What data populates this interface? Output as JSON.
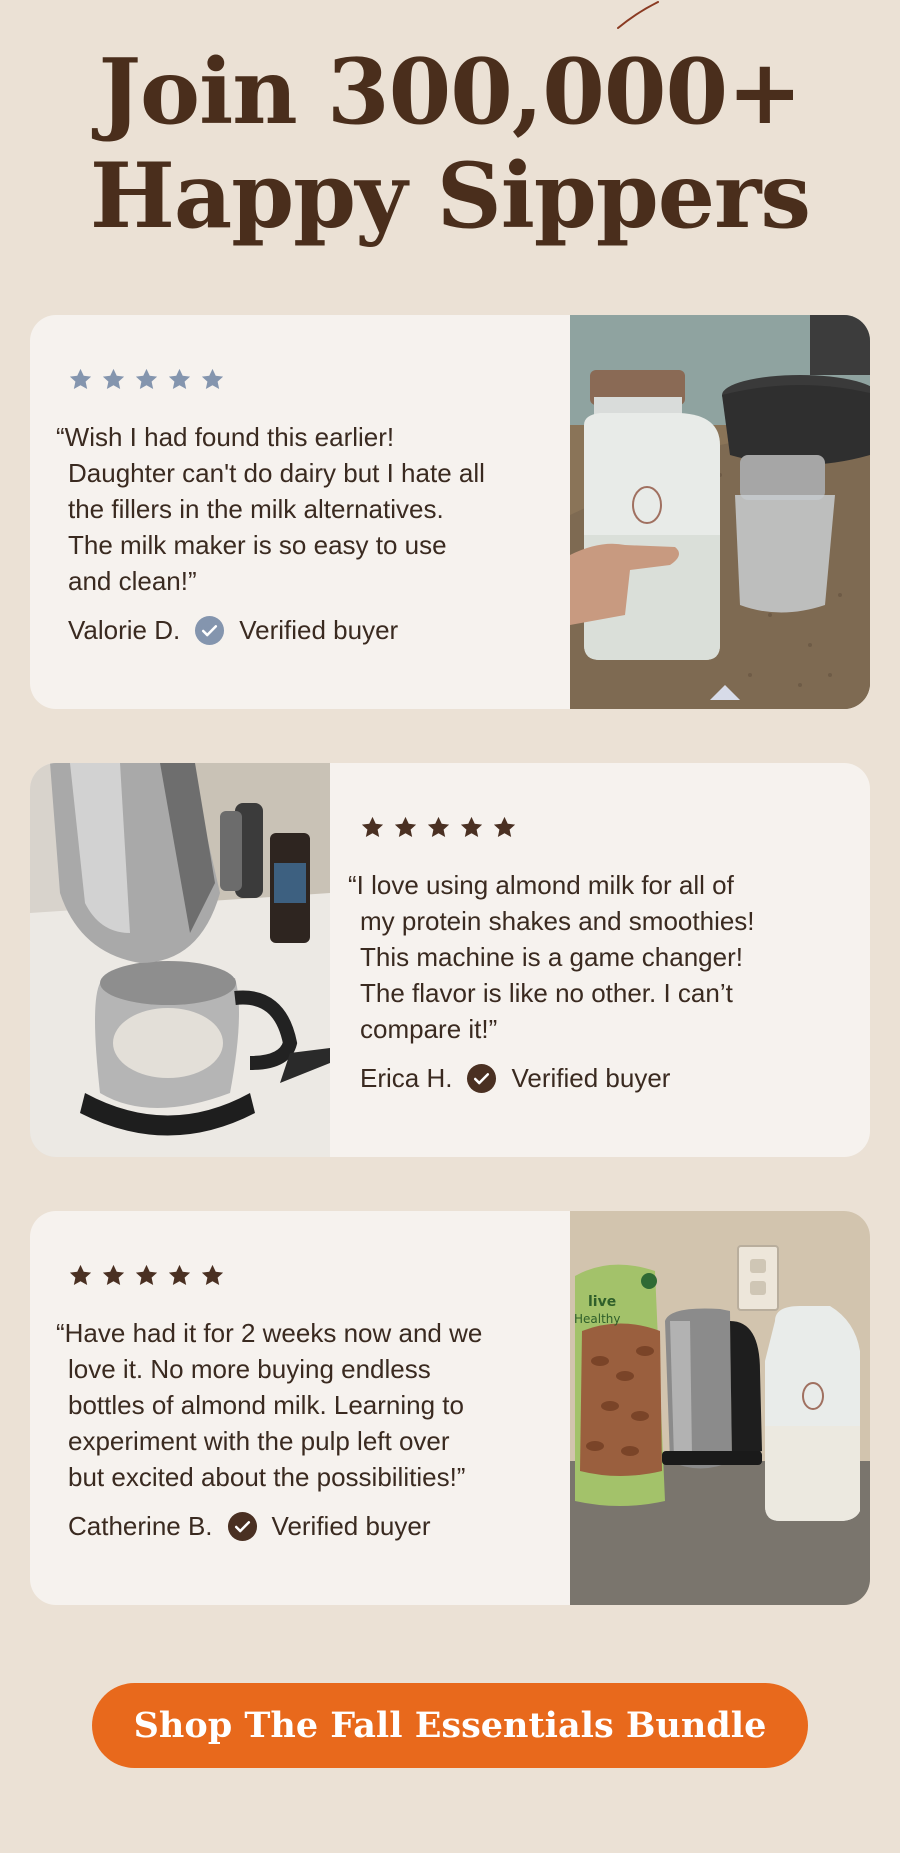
{
  "headline": {
    "line1": "Join 300,000+",
    "line2": "Happy Sippers"
  },
  "reviews": [
    {
      "rating": 5,
      "star_color": "#8495ae",
      "quote": "“Wish I had found this earlier!\nDaughter can't do dairy but I hate all\nthe fillers in the milk alternatives.\nThe milk maker is so easy to use\nand clean!”",
      "name": "Valorie D.",
      "verified_label": "Verified buyer",
      "check_color": "#8495ae"
    },
    {
      "rating": 5,
      "star_color": "#4a3022",
      "quote": "“I love using almond milk for all of\nmy protein shakes and smoothies!\nThis machine is a game changer!\nThe flavor is like no other. I can’t\ncompare it!”",
      "name": "Erica H.",
      "verified_label": "Verified buyer",
      "check_color": "#4a3022"
    },
    {
      "rating": 5,
      "star_color": "#4a3022",
      "quote": "“Have had it for 2 weeks now and we\nlove it. No more buying endless\nbottles of almond milk. Learning to\nexperiment with the pulp left over\nbut excited about the possibilities!”",
      "name": "Catherine B.",
      "verified_label": "Verified buyer",
      "check_color": "#4a3022"
    }
  ],
  "photo_labels": {
    "bag_brand": "live",
    "bag_tag": "Healthy"
  },
  "cta": {
    "label": "Shop The Fall Essentials Bundle",
    "color": "#e8691c"
  },
  "colors": {
    "background": "#ebe1d5",
    "card": "#f6f2ee",
    "headline": "#4a2e1c"
  }
}
